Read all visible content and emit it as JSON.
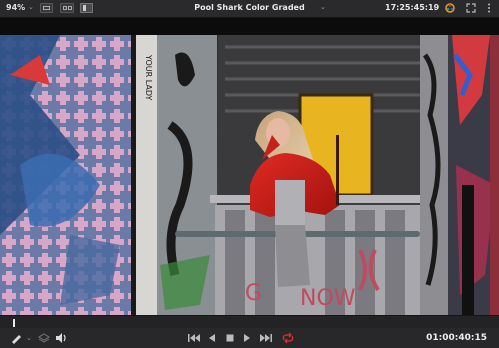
{
  "toolbar": {
    "zoom": "94%",
    "title": "Pool Shark Color Graded",
    "timecode": "17:25:45:19"
  },
  "viewer": {
    "content": "video-frame"
  },
  "transport": {
    "timecode": "01:00:40:15",
    "loop_color": "#d23030"
  },
  "colors": {
    "background": "#1c1c1e",
    "toolbar": "#2a2a2d",
    "accent_red": "#d23030"
  }
}
